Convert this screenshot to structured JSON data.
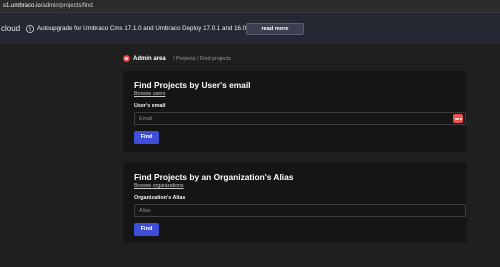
{
  "browser": {
    "url_host": "s1.umbraco.io",
    "url_path": "/admin/projects/find"
  },
  "header": {
    "brand": "cloud",
    "banner_text": "Autoupgrade for Umbraco Cms 17.1.0 and Umbraco Deploy 17.0.1 and 16.0.5 (Schedul...",
    "banner_button": "read more",
    "info_icon": "info-circle-icon"
  },
  "breadcrumb": {
    "icon": "admin-shield-icon",
    "admin_label": "Admin area",
    "rest": "/ Projects / Find projects"
  },
  "card_email": {
    "title": "Find Projects by User's email",
    "link": "Browse users",
    "label": "User's email",
    "placeholder": "Email",
    "button": "Find",
    "password_manager_icon": "password-manager-icon"
  },
  "card_alias": {
    "title": "Find Projects by an Organization's Alias",
    "link": "Browse organizations",
    "label": "Organization's Alias",
    "placeholder": "Alias",
    "button": "Find"
  },
  "colors": {
    "background": "#1f1f1f",
    "header": "#252733",
    "card": "#151515",
    "primary_button": "#3e4ed6",
    "admin_icon": "#e8524f"
  }
}
